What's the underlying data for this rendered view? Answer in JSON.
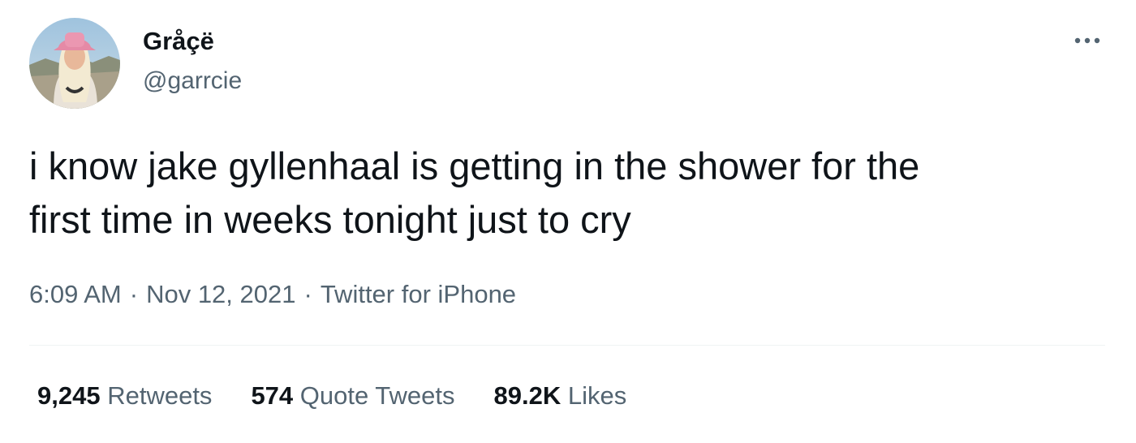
{
  "author": {
    "display_name": "Gråçë",
    "handle": "@garrcie",
    "avatar_icon": "profile-photo"
  },
  "menu": {
    "more_icon": "more-options-icon"
  },
  "tweet": {
    "text": "i know jake gyllenhaal is getting in the shower for the\nfirst time in weeks tonight just to cry"
  },
  "meta": {
    "time": "6:09 AM",
    "separator": "·",
    "date": "Nov 12, 2021",
    "source": "Twitter for iPhone"
  },
  "stats": {
    "retweets": {
      "count": "9,245",
      "label": "Retweets"
    },
    "quote_tweets": {
      "count": "574",
      "label": "Quote Tweets"
    },
    "likes": {
      "count": "89.2K",
      "label": "Likes"
    }
  },
  "colors": {
    "text_primary": "#0f1419",
    "text_secondary": "#536471",
    "divider": "#eff3f4"
  }
}
